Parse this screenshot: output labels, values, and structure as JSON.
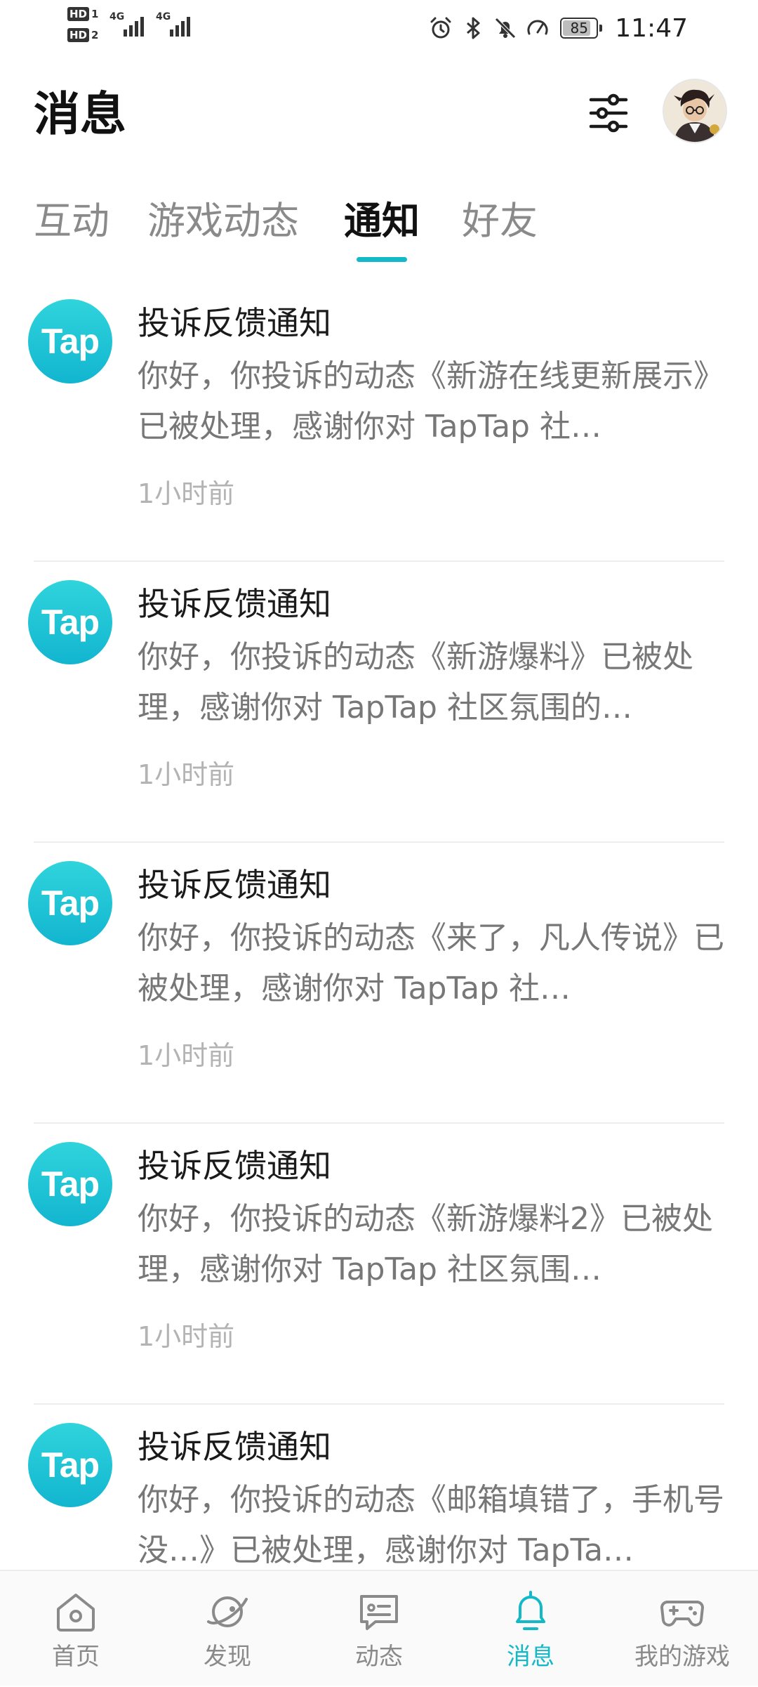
{
  "status_bar": {
    "sim1": {
      "badge": "HD",
      "index": "1"
    },
    "sim2": {
      "badge": "HD",
      "index": "2"
    },
    "network_1": "4G",
    "network_2": "4G",
    "battery": "85",
    "battery_level": 0.85,
    "time": "11:47"
  },
  "header": {
    "title": "消息",
    "filter_icon": "sliders-icon",
    "avatar_icon": "user-avatar"
  },
  "tabs": [
    {
      "label": "互动",
      "active": false
    },
    {
      "label": "游戏动态",
      "active": false
    },
    {
      "label": "通知",
      "active": true
    },
    {
      "label": "好友",
      "active": false
    }
  ],
  "notifications": [
    {
      "logo": "Tap",
      "title": "投诉反馈通知",
      "body": "你好，你投诉的动态《新游在线更新展示》已被处理，感谢你对 TapTap 社…",
      "time": "1小时前"
    },
    {
      "logo": "Tap",
      "title": "投诉反馈通知",
      "body": "你好，你投诉的动态《新游爆料》已被处理，感谢你对 TapTap 社区氛围的…",
      "time": "1小时前"
    },
    {
      "logo": "Tap",
      "title": "投诉反馈通知",
      "body": "你好，你投诉的动态《来了，凡人传说》已被处理，感谢你对 TapTap 社…",
      "time": "1小时前"
    },
    {
      "logo": "Tap",
      "title": "投诉反馈通知",
      "body": "你好，你投诉的动态《新游爆料2》已被处理，感谢你对 TapTap 社区氛围…",
      "time": "1小时前"
    },
    {
      "logo": "Tap",
      "title": "投诉反馈通知",
      "body": "你好，你投诉的动态《邮箱填错了，手机号没…》已被处理，感谢你对 TapTa…",
      "time": ""
    }
  ],
  "bottom_nav": [
    {
      "label": "首页",
      "icon": "home-icon",
      "active": false
    },
    {
      "label": "发现",
      "icon": "discover-icon",
      "active": false
    },
    {
      "label": "动态",
      "icon": "feed-icon",
      "active": false
    },
    {
      "label": "消息",
      "icon": "bell-icon",
      "active": true
    },
    {
      "label": "我的游戏",
      "icon": "gamepad-icon",
      "active": false
    }
  ],
  "colors": {
    "accent": "#14b9c8",
    "logo_gradient_top": "#2fd4dc",
    "logo_gradient_bottom": "#12b5cf",
    "muted_text": "#777777",
    "time_text": "#b3b3b3"
  }
}
